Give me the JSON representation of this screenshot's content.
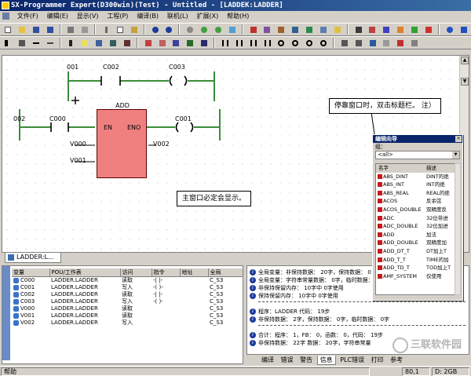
{
  "window": {
    "title": "SX-Programmer Expert(D300win)(Test) - Untitled - [LADDEK:LADDER]"
  },
  "menu": [
    "文件(F)",
    "编辑(E)",
    "显示(V)",
    "工程(P)",
    "编译(B)",
    "联机(L)",
    "扩展(X)",
    "帮助(H)"
  ],
  "ladder": {
    "rung1": {
      "contact1": "001",
      "contact2": "C002",
      "coil": "C003"
    },
    "rung2": {
      "rail_label": "002",
      "contact": "C000",
      "coil": "C001",
      "block": {
        "title": "ADD",
        "en": "EN",
        "eno": "ENO"
      },
      "in1": "V000",
      "in2": "V001",
      "out": "V002"
    },
    "callout_right": "停靠窗口时，双击标题栏。 注）",
    "callout_center": "主窗口必定会显示。"
  },
  "doc_tab": "LADDER:L...",
  "variables": {
    "headers": [
      "变量",
      "POU/工作表",
      "访问",
      "指令",
      "地址",
      "全局"
    ],
    "rows": [
      [
        "C000",
        "LADDER.LADDER",
        "读取",
        "-| |-",
        "",
        "C_S3"
      ],
      [
        "C001",
        "LADDER.LADDER",
        "写入",
        "-( )-",
        "",
        "C_S3"
      ],
      [
        "C002",
        "LADDER.LADDER",
        "读取",
        "-| |-",
        "",
        "C_S3"
      ],
      [
        "C003",
        "LADDER.LADDER",
        "写入",
        "-( )-",
        "",
        "C_S3"
      ],
      [
        "V000",
        "LADDER.LADDER",
        "读取",
        "",
        "",
        "C_S3"
      ],
      [
        "V001",
        "LADDER.LADDER",
        "读取",
        "",
        "",
        "C_S3"
      ],
      [
        "V002",
        "LADDER.LADDER",
        "写入",
        "",
        "",
        "C_S3"
      ]
    ]
  },
  "info": {
    "lines": [
      "全局变量：非保持数据：        20字，保持数据：        0",
      "全局变量：字符串常量数据：      0字，临时数据：",
      "非保持保留内存：       10字中      0字使用",
      "保持保留内存：       10字中      0字使用",
      "程序：LADDER   代码：       19步",
      "非保持数据：      2字，保持数据：       0字，临时数据：       0字",
      "合计：程序：   1，FB：    0，函数：    0，代码：       19步",
      "非保持数据：       22字        数据：       20字，字符串常量"
    ]
  },
  "bottom_tabs": [
    "编译",
    "错误",
    "警告",
    "信息",
    "PLC错误",
    "打印",
    "参考"
  ],
  "bottom_tabs_active": 3,
  "floating": {
    "title": "编辑向导",
    "group_label": "组：",
    "group_value": "<all>",
    "col1": "名字",
    "col2": "描述",
    "rows": [
      [
        "ABS_DINT",
        "DINT的绝"
      ],
      [
        "ABS_INT",
        "INT的绝"
      ],
      [
        "ABS_REAL",
        "REAL的绝"
      ],
      [
        "ACOS",
        "反余弦"
      ],
      [
        "ACOS_DOUBLE",
        "双精度反"
      ],
      [
        "ADC",
        "32位带进"
      ],
      [
        "ADC_DOUBLE",
        "32位加进"
      ],
      [
        "ADD",
        "加法"
      ],
      [
        "ADD_DOUBLE",
        "双精度加"
      ],
      [
        "ADD_DT_T",
        "DT加上T"
      ],
      [
        "ADD_T_T",
        "TIME的加"
      ],
      [
        "ADD_TD_T",
        "TOD加上T"
      ],
      [
        "AMF_SYSTEM",
        "仅使用"
      ]
    ]
  },
  "status": {
    "help": "帮助",
    "pos": "80,1",
    "mem": "D: 2GB"
  },
  "watermark": "三联软件园"
}
